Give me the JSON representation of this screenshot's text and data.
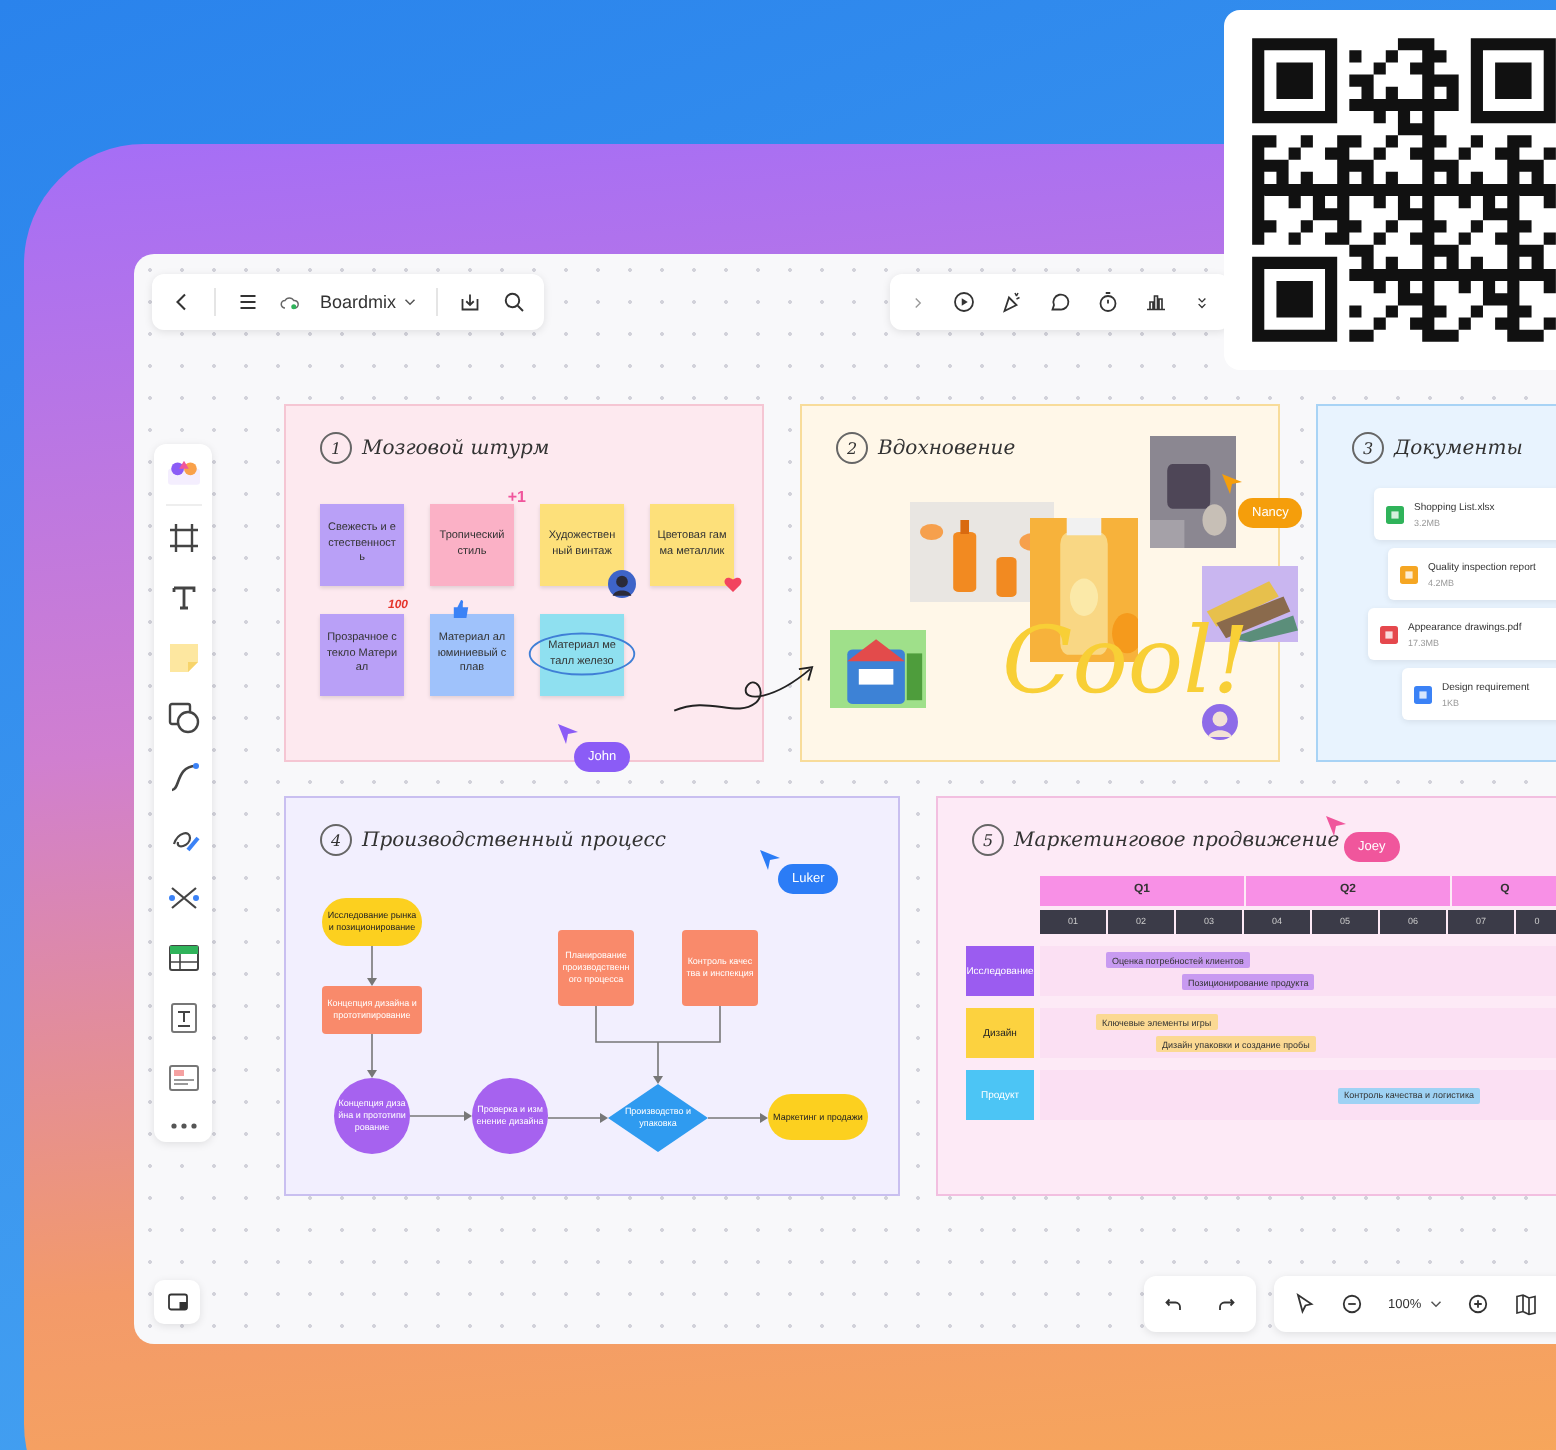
{
  "toolbar": {
    "app_name": "Boardmix"
  },
  "frames": [
    {
      "number": "1",
      "title": "Мозговой штурм",
      "kind": "stickies",
      "notes": [
        {
          "text": "Свежесть и естественность",
          "color": "#b9a0f7"
        },
        {
          "text": "Тропический стиль",
          "color": "#fbb1c6",
          "decoration": {
            "kind": "badge",
            "text": "+1"
          }
        },
        {
          "text": "Художественный винтаж",
          "color": "#fde07a",
          "decoration": {
            "kind": "avatar"
          }
        },
        {
          "text": "Цветовая гамма металлик",
          "color": "#fde07a",
          "decoration": {
            "kind": "heart"
          }
        },
        {
          "text": "Прозрачное стекло Материал",
          "color": "#b9a0f7",
          "decoration": {
            "kind": "badge",
            "text": "100"
          }
        },
        {
          "text": "Материал алюминиевый сплав",
          "color": "#9fc2fb",
          "decoration": {
            "kind": "thumb"
          }
        },
        {
          "text": "Материал металл железо",
          "color": "#8fe0f0",
          "decoration": {
            "kind": "circle"
          }
        }
      ]
    },
    {
      "number": "2",
      "title": "Вдохновение",
      "kind": "moodboard",
      "handwriting": "Cool!"
    },
    {
      "number": "3",
      "title": "Документы",
      "kind": "documents",
      "documents": [
        {
          "name": "Shopping List.xlsx",
          "size": "3.2MB",
          "kind": "sheet"
        },
        {
          "name": "Quality inspection report",
          "size": "4.2MB",
          "kind": "slides"
        },
        {
          "name": "Appearance drawings.pdf",
          "size": "17.3MB",
          "kind": "pdf"
        },
        {
          "name": "Design requirement",
          "size": "1KB",
          "kind": "doc"
        }
      ]
    },
    {
      "number": "4",
      "title": "Производственный процесс",
      "kind": "flowchart",
      "nodes": [
        {
          "kind": "terminator",
          "text": "Исследование рынка и позиционирование"
        },
        {
          "kind": "process",
          "text": "Концепция дизайна и прототипирование"
        },
        {
          "kind": "circle",
          "text": "Концепция дизайна и прототипирование"
        },
        {
          "kind": "circle",
          "text": "Проверка и изменение дизайна"
        },
        {
          "kind": "decision",
          "text": "Производство и упаковка"
        },
        {
          "kind": "terminator",
          "text": "Маркетинг и продажи"
        },
        {
          "kind": "process",
          "text": "Планирование производственного процесса"
        },
        {
          "kind": "process",
          "text": "Контроль качества и инспекция"
        }
      ]
    },
    {
      "number": "5",
      "title": "Маркетинговое продвижение",
      "kind": "gantt",
      "quarters": [
        "Q1",
        "Q2",
        "Q"
      ],
      "months": [
        "01",
        "02",
        "03",
        "04",
        "05",
        "06",
        "07",
        "0"
      ],
      "rows": [
        {
          "label": "Исследование",
          "color": "#9b5cf0",
          "tasks": [
            "Оценка потребностей клиентов",
            "Позиционирование продукта"
          ]
        },
        {
          "label": "Дизайн",
          "color": "#fcd23f",
          "tasks": [
            "Ключевые элементы игры",
            "Дизайн упаковки и создание пробы"
          ]
        },
        {
          "label": "Продукт",
          "color": "#4cc5f5",
          "tasks": [
            "Контроль качества и логистика"
          ]
        }
      ]
    }
  ],
  "collaborators": [
    {
      "name": "Nancy",
      "color": "#f59e0b"
    },
    {
      "name": "John",
      "color": "#8b5cf6"
    },
    {
      "name": "Luker",
      "color": "#2b7cf6"
    },
    {
      "name": "Joey",
      "color": "#f0569c"
    }
  ],
  "zoom": "100%"
}
